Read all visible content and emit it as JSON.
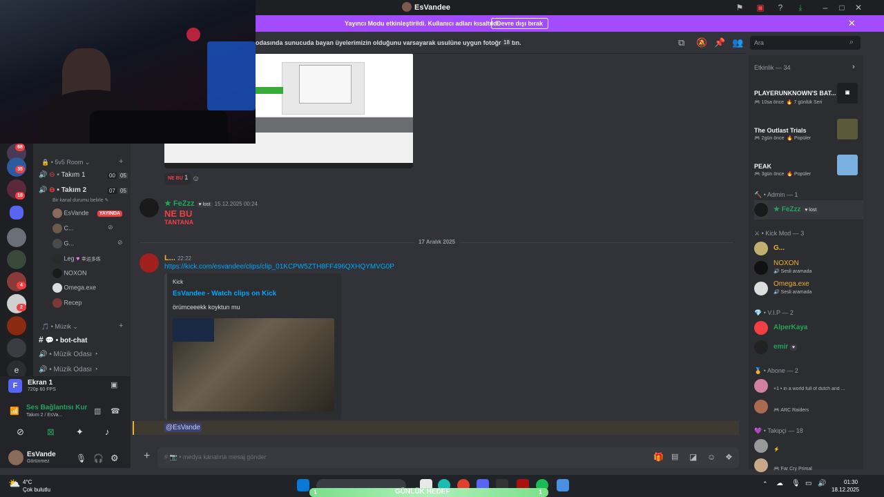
{
  "window": {
    "title": "EsVandee"
  },
  "banner": {
    "text": "Yayıncı Modu etkinleştirildi. Kullanıcı adları kısaltıldı.",
    "button": "Devre dışı bırak"
  },
  "channel_header": {
    "topic": "odasında sunucuda bayan üyelerimizin olduğunu varsayarak usulüne uygun fotoğraf atın.",
    "age_badge": "18"
  },
  "search": {
    "placeholder": "Ara"
  },
  "guild_badges": [
    "68",
    "35",
    "18",
    "4",
    "2"
  ],
  "channels": {
    "room_category": "5v5 Room",
    "team1": "Takım 1",
    "team1_a": "00",
    "team1_b": "05",
    "team2": "Takım 2",
    "team2_a": "07",
    "team2_b": "05",
    "team2_status": "Bir kanal durumu belirle",
    "members": [
      {
        "name": "EsVande",
        "badge": "YAYINDA"
      },
      {
        "name": "C..."
      },
      {
        "name": "G..."
      },
      {
        "name": "Leg",
        "extra": "幸运多练"
      },
      {
        "name": "NOXON"
      },
      {
        "name": "Omega.exe"
      },
      {
        "name": "Recep"
      }
    ],
    "music_category": "Müzik",
    "bot_chat": "bot-chat",
    "music_room1": "Müzik Odası",
    "music_room2": "Müzik Odası"
  },
  "screen_share": {
    "title": "Ekran 1",
    "sub": "720p 60 FPS"
  },
  "voice": {
    "status": "Ses Bağlantısı Kurul",
    "sub": "Takım 2 / EsVa..."
  },
  "user": {
    "name": "EsVande",
    "status": "Görünmez"
  },
  "messages": {
    "reaction_count": "1",
    "msg1": {
      "author": "FeZzz",
      "tag": "lost",
      "time": "15.12.2025 00:24",
      "img_line1": "NE BU",
      "img_line2": "TANTANA"
    },
    "date_divider": "17 Aralık 2025",
    "msg2": {
      "author": "L...",
      "time": "22:22",
      "link": "https://kick.com/esvandee/clips/clip_01KCPW5ZTH8FF496QXHQYMVG0P",
      "embed_provider": "Kick",
      "embed_title": "EsVandee - Watch clips on Kick",
      "embed_desc": "örümceeekk koyktun mu"
    },
    "mention": "@EsVande"
  },
  "composer": {
    "placeholder": "medya kanalına mesaj gönder"
  },
  "members": {
    "activity_header": "Etkinlik — 34",
    "activities": [
      {
        "game": "PLAYERUNKNOWN'S BAT...",
        "time": "10sa önce",
        "note": "7 günlük Seri"
      },
      {
        "game": "The Outlast Trials",
        "time": "2gün önce",
        "note": "Popüler"
      },
      {
        "game": "PEAK",
        "time": "3gün önce",
        "note": "Popüler"
      }
    ],
    "admin_header": "Admin — 1",
    "admin": [
      {
        "name": "FeZzz",
        "tag": "lost"
      }
    ],
    "kickmod_header": "Kick Mod — 3",
    "kickmod": [
      {
        "name": "G...",
        "sub": ""
      },
      {
        "name": "NOXON",
        "sub": "Sesli aramada"
      },
      {
        "name": "Omega.exe",
        "sub": "Sesli aramada"
      }
    ],
    "vip_header": "V.I.P — 2",
    "vip": [
      {
        "name": "AlperKaya",
        "sub": ""
      },
      {
        "name": "emir",
        "sub": ""
      }
    ],
    "abone_header": "Abone — 2",
    "abone": [
      {
        "name": "",
        "sub": "+1 • in a world full of dutch and ..."
      },
      {
        "name": "",
        "sub": "ARC Raiders"
      }
    ],
    "takipci_header": "Takipçi — 18",
    "takipci": [
      {
        "name": "",
        "sub": ""
      },
      {
        "name": "",
        "sub": "Far Cry Primal"
      }
    ]
  },
  "taskbar": {
    "weather_temp": "4°C",
    "weather_desc": "Çok bulutlu",
    "widget_label": "GÜNLÜK HEDEF",
    "widget_left": "1",
    "widget_right": "1",
    "time": "01:30",
    "date": "18.12.2025"
  },
  "colors": {
    "accent": "#a34bff",
    "link": "#00a8fc",
    "green": "#23a55a",
    "red": "#f23f43",
    "orange": "#f0b232"
  }
}
